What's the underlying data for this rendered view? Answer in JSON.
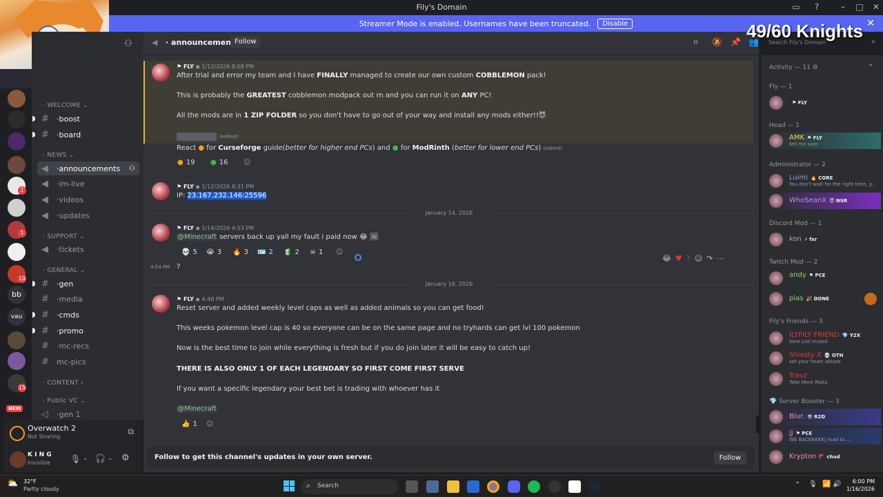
{
  "window": {
    "title": "Fily's Domain"
  },
  "banner": {
    "text": "Streamer Mode is enabled. Usernames have been truncated.",
    "button": "Disable"
  },
  "overlay": {
    "text": "49/60 Knights"
  },
  "channels": {
    "categories": [
      "WELCOME",
      "NEWS",
      "SUPPORT",
      "GENERAL",
      "CONTENT",
      "Public VC"
    ],
    "items": [
      "boost",
      "board",
      "announcements",
      "im-live",
      "videos",
      "updates",
      "tickets",
      "gen",
      "media",
      "cmds",
      "promo",
      "mc-recs",
      "mc-pics",
      "gen 1"
    ]
  },
  "game": {
    "name": "Overwatch 2",
    "status": "Not Sharing"
  },
  "user": {
    "name": "K I N G",
    "status": "Invisible"
  },
  "header": {
    "channel": "announcements",
    "follow": "Follow",
    "search_placeholder": "Search Fily's Domain"
  },
  "messages": [
    {
      "role": "FLY",
      "time": "1/12/2026 8:08 PM",
      "lines": [
        "After trial and error my team and I have FINALLY managed to create our own custom COBBLEMON pack!",
        "This is probably the GREATEST cobblemon modpack out rn and you can run it on ANY PC!",
        "All the mods are in 1 ZIP FOLDER so you don't have to go out of your way and install any mods either!!"
      ],
      "react_line": "React for Curseforge guide(better for higher end PCs) and for ModRinth (better for lower end PCs)",
      "edited": "(edited)",
      "reactions": [
        "19",
        "16"
      ]
    },
    {
      "role": "FLY",
      "time": "1/12/2026 8:31 PM",
      "ip_label": "IP:",
      "ip": "23.167.232.146:25596"
    },
    {
      "date": "January 14, 2026",
      "role": "FLY",
      "time": "1/14/2026 4:53 PM",
      "mention": "@Minecraft",
      "text": "servers back up yall my fault i paid now",
      "reactions": [
        "5",
        "3",
        "3",
        "2",
        "2",
        "1"
      ]
    },
    {
      "time": "4:54 PM",
      "text": "?"
    },
    {
      "date": "January 16, 2026",
      "role": "FLY",
      "time": "4:46 PM",
      "lines": [
        "Reset server and added weekly level caps as well as added animals so you can get food!",
        "This weeks pokemon level cap is 40 so everyone can be on the same page and no tryhards can get lvl 100 pokemon",
        "Now is the best time to join while everything is fresh but if you do join later it will be easy to catch up!",
        "THERE IS ALSO ONLY 1 OF EACH LEGENDARY SO FIRST COME FIRST SERVE",
        "If you want a specific legendary your best bet is trading with whoever has it"
      ],
      "mention": "@Minecraft",
      "reactions": [
        "1"
      ]
    }
  ],
  "followbar": {
    "text": "Follow to get this channel's updates in your own server.",
    "button": "Follow"
  },
  "members": {
    "activity": "Activity — 11",
    "groups": [
      {
        "title": "Fly — 1",
        "members": [
          {
            "name": "",
            "tag": "FLY"
          }
        ]
      },
      {
        "title": "Head — 1",
        "members": [
          {
            "name": "AMK",
            "tag": "FLY",
            "sub": "tell me sum"
          }
        ]
      },
      {
        "title": "Administrator — 2",
        "members": [
          {
            "name": "Luimi",
            "tag": "CORE",
            "sub": "You don't wait for the right time, y..."
          },
          {
            "name": "WhoSeanX",
            "tag": "NSR"
          }
        ]
      },
      {
        "title": "Discord Mod — 1",
        "members": [
          {
            "name": "kon",
            "tag": "fxr"
          }
        ]
      },
      {
        "title": "Twitch Mod — 2",
        "members": [
          {
            "name": "andy",
            "tag": "PCE"
          },
          {
            "name": "plas",
            "tag": "DONE"
          }
        ]
      },
      {
        "title": "Fily's Friends — 3",
        "members": [
          {
            "name": "ILYFILY FRIEND",
            "tag": "Y2X",
            "sub": "here just muted"
          },
          {
            "name": "Shiesty X",
            "tag": "OTH",
            "sub": "set your heart ablaze"
          },
          {
            "name": "Travz",
            "sub": "Take More Risks"
          }
        ]
      },
      {
        "title": "Server Booster — 3",
        "members": [
          {
            "name": "Blur.",
            "tag": "R2D"
          },
          {
            "name": "jj",
            "tag": "PCE",
            "sub": "WE BACKKKKK| road to ..."
          },
          {
            "name": "Krypton",
            "tag": "chud"
          }
        ]
      }
    ]
  },
  "taskbar": {
    "weather_temp": "32°F",
    "weather_desc": "Partly cloudy",
    "search": "Search",
    "time": "6:00 PM",
    "date": "1/16/2026"
  },
  "colors": {
    "accent": "#5865f2",
    "bg": "#313338",
    "green": "#23a55a"
  }
}
